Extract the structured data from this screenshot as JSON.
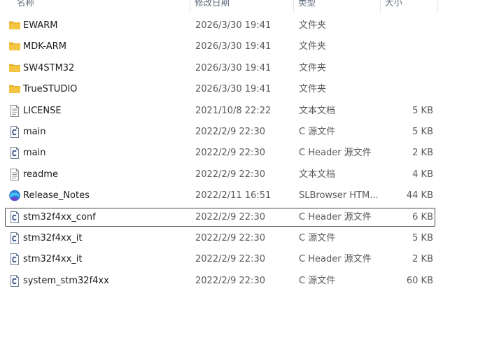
{
  "columns": {
    "name": "名称",
    "date": "修改日期",
    "type": "类型",
    "size": "大小"
  },
  "colors": {
    "folder": "#f4c542",
    "selection_border": "#4a4a4a",
    "header_text": "#5d6a7a"
  },
  "files": [
    {
      "name": "EWARM",
      "date": "2026/3/30 19:41",
      "type": "文件夹",
      "size": "",
      "icon": "folder-icon",
      "selected": false
    },
    {
      "name": "MDK-ARM",
      "date": "2026/3/30 19:41",
      "type": "文件夹",
      "size": "",
      "icon": "folder-icon",
      "selected": false
    },
    {
      "name": "SW4STM32",
      "date": "2026/3/30 19:41",
      "type": "文件夹",
      "size": "",
      "icon": "folder-icon",
      "selected": false
    },
    {
      "name": "TrueSTUDIO",
      "date": "2026/3/30 19:41",
      "type": "文件夹",
      "size": "",
      "icon": "folder-icon",
      "selected": false
    },
    {
      "name": "LICENSE",
      "date": "2021/10/8 22:22",
      "type": "文本文档",
      "size": "5 KB",
      "icon": "text-file-icon",
      "selected": false
    },
    {
      "name": "main",
      "date": "2022/2/9 22:30",
      "type": "C 源文件",
      "size": "5 KB",
      "icon": "c-file-icon",
      "selected": false
    },
    {
      "name": "main",
      "date": "2022/2/9 22:30",
      "type": "C Header 源文件",
      "size": "2 KB",
      "icon": "c-file-icon",
      "selected": false
    },
    {
      "name": "readme",
      "date": "2022/2/9 22:30",
      "type": "文本文档",
      "size": "4 KB",
      "icon": "text-file-icon",
      "selected": false
    },
    {
      "name": "Release_Notes",
      "date": "2022/2/11 16:51",
      "type": "SLBrowser HTM...",
      "size": "44 KB",
      "icon": "browser-icon",
      "selected": false
    },
    {
      "name": "stm32f4xx_conf",
      "date": "2022/2/9 22:30",
      "type": "C Header 源文件",
      "size": "6 KB",
      "icon": "c-file-icon",
      "selected": true
    },
    {
      "name": "stm32f4xx_it",
      "date": "2022/2/9 22:30",
      "type": "C 源文件",
      "size": "5 KB",
      "icon": "c-file-icon",
      "selected": false
    },
    {
      "name": "stm32f4xx_it",
      "date": "2022/2/9 22:30",
      "type": "C Header 源文件",
      "size": "2 KB",
      "icon": "c-file-icon",
      "selected": false
    },
    {
      "name": "system_stm32f4xx",
      "date": "2022/2/9 22:30",
      "type": "C 源文件",
      "size": "60 KB",
      "icon": "c-file-icon",
      "selected": false
    }
  ]
}
